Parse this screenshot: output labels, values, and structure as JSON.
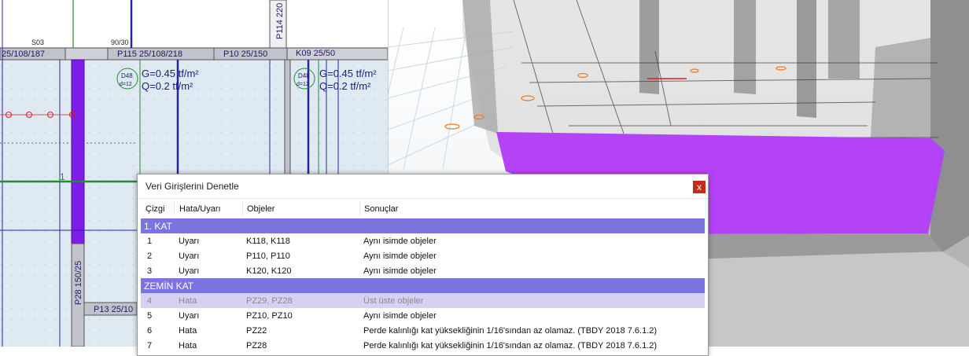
{
  "dialog": {
    "title": "Veri Girişlerini Denetle",
    "close_glyph": "x",
    "columns": [
      "Çizgi",
      "Hata/Uyarı",
      "Objeler",
      "Sonuçlar"
    ],
    "groups": [
      {
        "name": "1. KAT",
        "rows": [
          {
            "line": "1",
            "type": "Uyarı",
            "objects": "K118, K118",
            "result": "Aynı isimde objeler"
          },
          {
            "line": "2",
            "type": "Uyarı",
            "objects": "P110, P110",
            "result": "Aynı isimde objeler"
          },
          {
            "line": "3",
            "type": "Uyarı",
            "objects": "K120, K120",
            "result": "Aynı isimde objeler"
          }
        ]
      },
      {
        "name": "ZEMİN KAT",
        "rows": [
          {
            "line": "4",
            "type": "Hata",
            "objects": "PZ29, PZ28",
            "result": "Üst üste objeler",
            "selected": true
          },
          {
            "line": "5",
            "type": "Uyarı",
            "objects": "PZ10, PZ10",
            "result": "Aynı isimde objeler"
          },
          {
            "line": "6",
            "type": "Hata",
            "objects": "PZ22",
            "result": "Perde kalınlığı kat yüksekliğinin 1/16'sından az olamaz.  (TBDY 2018 7.6.1.2)"
          },
          {
            "line": "7",
            "type": "Hata",
            "objects": "PZ28",
            "result": "Perde kalınlığı kat yüksekliğinin 1/16'sından az olamaz.  (TBDY 2018 7.6.1.2)"
          }
        ]
      }
    ]
  },
  "plan": {
    "labels": {
      "s03": "S03",
      "dim_9030": "90/30",
      "beam_left": "25/108/187",
      "p115": "P115 25/108/218",
      "p10": "P10 25/150",
      "k09": "K09 25/50",
      "p114": "P114 220",
      "slab1_id": "D48",
      "slab1_d": "d=12",
      "slab2_id": "D48",
      "slab2_d": "d=12",
      "load_g1": "G=0.45 tf/m²",
      "load_q1": "Q=0.2 tf/m²",
      "load_g2": "G=0.45 tf/m²",
      "load_q2": "Q=0.2 tf/m²",
      "axis_1": "1",
      "p28": "P28 150/25",
      "p13": "P13 25/10"
    }
  },
  "colors": {
    "plan_bg": "#dfe9f2",
    "beam_fill": "#c2c2cc",
    "column_purple": "#7d1de6",
    "slab_magenta": "#b543f6",
    "group_header": "#7b74dd",
    "selected_row": "#d4d1f2",
    "close_button": "#c42b1c"
  }
}
